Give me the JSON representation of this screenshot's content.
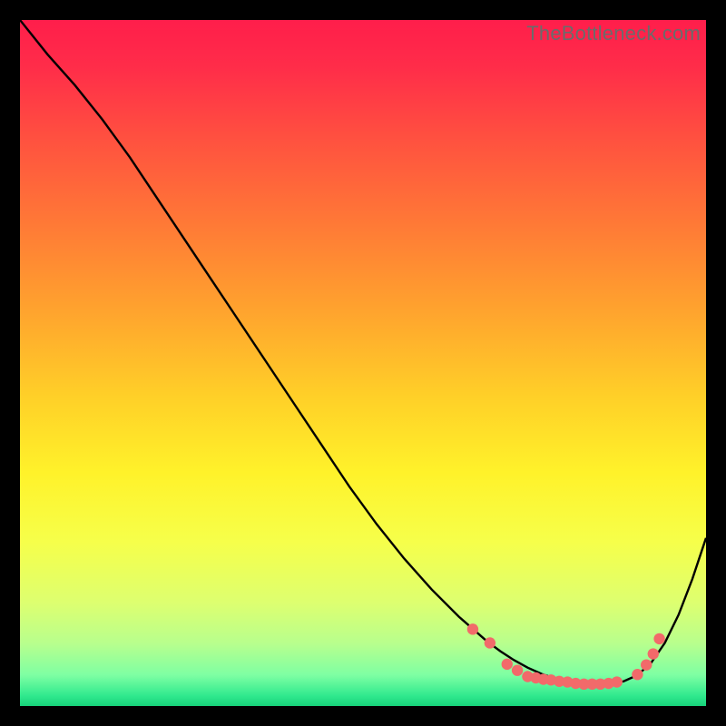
{
  "attribution": "TheBottleneck.com",
  "chart_data": {
    "type": "line",
    "title": "",
    "xlabel": "",
    "ylabel": "",
    "xlim": [
      0,
      100
    ],
    "ylim": [
      0,
      100
    ],
    "grid": false,
    "legend": false,
    "background_gradient": {
      "stops": [
        {
          "offset": 0.0,
          "color": "#ff1e4b"
        },
        {
          "offset": 0.07,
          "color": "#ff2d49"
        },
        {
          "offset": 0.18,
          "color": "#ff533f"
        },
        {
          "offset": 0.3,
          "color": "#ff7a36"
        },
        {
          "offset": 0.42,
          "color": "#ffa22e"
        },
        {
          "offset": 0.55,
          "color": "#ffd028"
        },
        {
          "offset": 0.66,
          "color": "#fff22a"
        },
        {
          "offset": 0.76,
          "color": "#f6ff4a"
        },
        {
          "offset": 0.85,
          "color": "#ddff70"
        },
        {
          "offset": 0.91,
          "color": "#b7ff8e"
        },
        {
          "offset": 0.955,
          "color": "#7effa3"
        },
        {
          "offset": 0.985,
          "color": "#30e98e"
        },
        {
          "offset": 1.0,
          "color": "#17d27a"
        }
      ]
    },
    "series": [
      {
        "name": "curve",
        "color": "#000000",
        "width": 2.4,
        "x": [
          0,
          4,
          8,
          12,
          16,
          20,
          24,
          28,
          32,
          36,
          40,
          44,
          48,
          52,
          56,
          60,
          64,
          68,
          70,
          72,
          74,
          76,
          78,
          80,
          82,
          84,
          86,
          88,
          90,
          92,
          94,
          96,
          98,
          100
        ],
        "y": [
          100,
          95,
          90.5,
          85.5,
          80,
          74,
          68,
          62,
          56,
          50,
          44,
          38,
          32,
          26.5,
          21.5,
          17,
          13,
          9.5,
          8,
          6.7,
          5.6,
          4.7,
          4.0,
          3.5,
          3.2,
          3.1,
          3.2,
          3.6,
          4.5,
          6.3,
          9.2,
          13.3,
          18.5,
          24.5
        ]
      }
    ],
    "markers": {
      "name": "dots",
      "color": "#f26a6a",
      "radius": 6.2,
      "points": [
        {
          "x": 66,
          "y": 11.2
        },
        {
          "x": 68.5,
          "y": 9.2
        },
        {
          "x": 71,
          "y": 6.1
        },
        {
          "x": 72.5,
          "y": 5.2
        },
        {
          "x": 74,
          "y": 4.3
        },
        {
          "x": 75.2,
          "y": 4.1
        },
        {
          "x": 76.3,
          "y": 3.9
        },
        {
          "x": 77.4,
          "y": 3.8
        },
        {
          "x": 78.6,
          "y": 3.6
        },
        {
          "x": 79.8,
          "y": 3.5
        },
        {
          "x": 81,
          "y": 3.3
        },
        {
          "x": 82.2,
          "y": 3.2
        },
        {
          "x": 83.4,
          "y": 3.2
        },
        {
          "x": 84.6,
          "y": 3.2
        },
        {
          "x": 85.8,
          "y": 3.3
        },
        {
          "x": 87,
          "y": 3.5
        },
        {
          "x": 90,
          "y": 4.6
        },
        {
          "x": 91.3,
          "y": 6.0
        },
        {
          "x": 92.3,
          "y": 7.6
        },
        {
          "x": 93.2,
          "y": 9.8
        }
      ]
    }
  }
}
